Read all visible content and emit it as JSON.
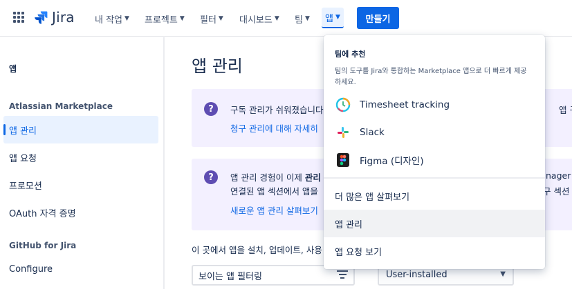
{
  "topnav": {
    "logo": "Jira",
    "items": [
      {
        "label": "내 작업"
      },
      {
        "label": "프로젝트"
      },
      {
        "label": "필터"
      },
      {
        "label": "대시보드"
      },
      {
        "label": "팀"
      },
      {
        "label": "앱"
      }
    ],
    "create_label": "만들기"
  },
  "sidebar": {
    "title": "앱",
    "section_marketplace": "Atlassian Marketplace",
    "items": [
      {
        "label": "앱 관리"
      },
      {
        "label": "앱 요청"
      },
      {
        "label": "프로모션"
      },
      {
        "label": "OAuth 자격 증명"
      }
    ],
    "section_github": "GitHub for Jira",
    "configure_label": "Configure"
  },
  "main": {
    "title": "앱 관리",
    "panel1": {
      "text": "구독 관리가 쉬워졌습니다",
      "link": "청구 관리에 대해 자세히",
      "right_text": "앱 구독을"
    },
    "panel2": {
      "line1_prefix": "앱 관리 경험이 이제 ",
      "line1_bold": "관리",
      "line2": "연결된 앱 섹션에서 앱을",
      "link": "새로운 앱 관리 살펴보기",
      "right_line1": "nager",
      "right_line2": "구 섹션"
    },
    "install_text": "이 곳에서 앱을 설치, 업데이트, 사용",
    "filter_value": "보이는 앱 필터링",
    "select_value": "User-installed"
  },
  "dropdown": {
    "header": "팀에 추천",
    "description": "팀의 도구를 Jira와 통합하는 Marketplace 앱으로 더 빠르게 제공하세요.",
    "apps": [
      {
        "label": "Timesheet tracking",
        "icon": "timesheet-icon"
      },
      {
        "label": "Slack",
        "icon": "slack-icon"
      },
      {
        "label": "Figma (디자인)",
        "icon": "figma-icon"
      }
    ],
    "actions": [
      {
        "label": "더 많은 앱 살펴보기"
      },
      {
        "label": "앱 관리"
      },
      {
        "label": "앱 요청 보기"
      }
    ]
  },
  "colors": {
    "brand": "#0c66e4",
    "panel_bg": "#f3f0ff",
    "question_icon": "#5e4db2"
  }
}
